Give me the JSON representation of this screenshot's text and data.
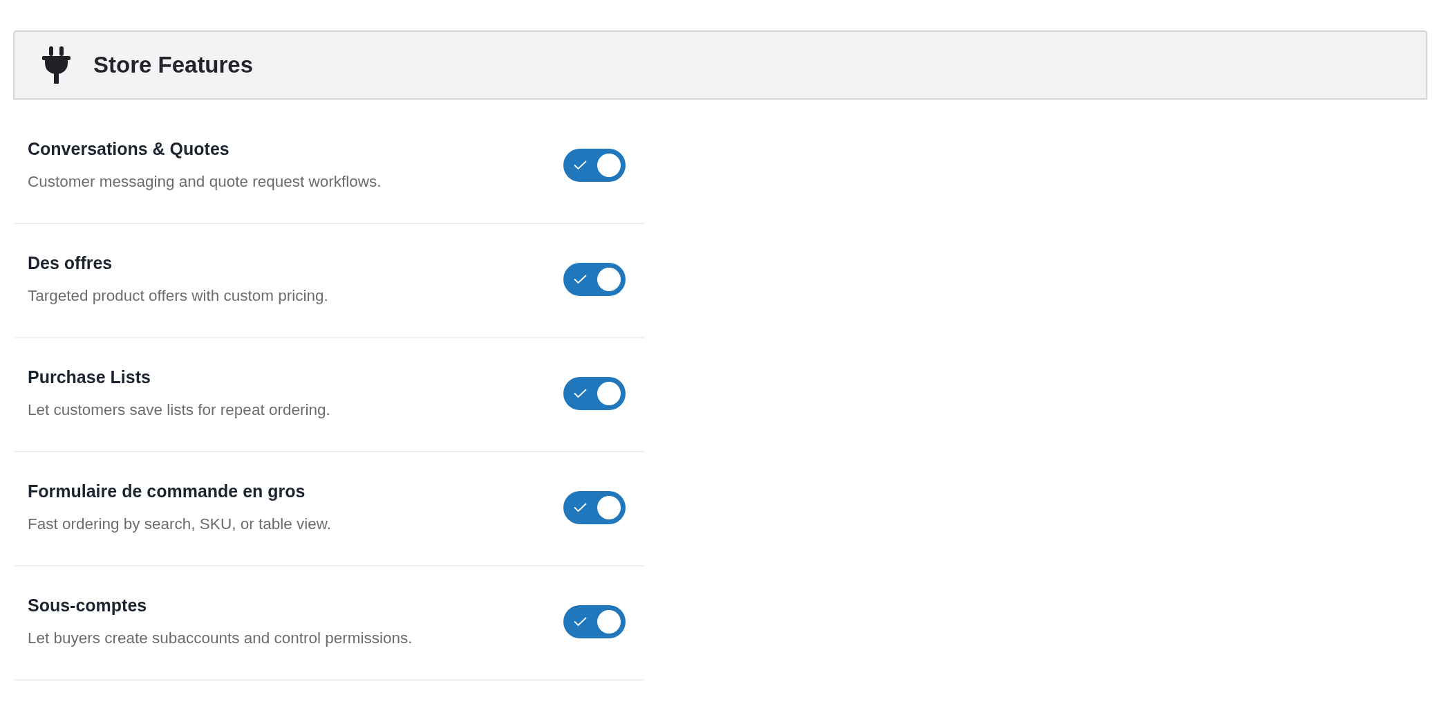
{
  "header": {
    "title": "Store Features"
  },
  "features": [
    {
      "title": "Conversations & Quotes",
      "description": "Customer messaging and quote request workflows.",
      "on": true
    },
    {
      "title": "Des offres",
      "description": "Targeted product offers with custom pricing.",
      "on": true
    },
    {
      "title": "Purchase Lists",
      "description": "Let customers save lists for repeat ordering.",
      "on": true
    },
    {
      "title": "Formulaire de commande en gros",
      "description": "Fast ordering by search, SKU, or table view.",
      "on": true
    },
    {
      "title": "Sous-comptes",
      "description": "Let buyers create subaccounts and control permissions.",
      "on": true
    }
  ]
}
